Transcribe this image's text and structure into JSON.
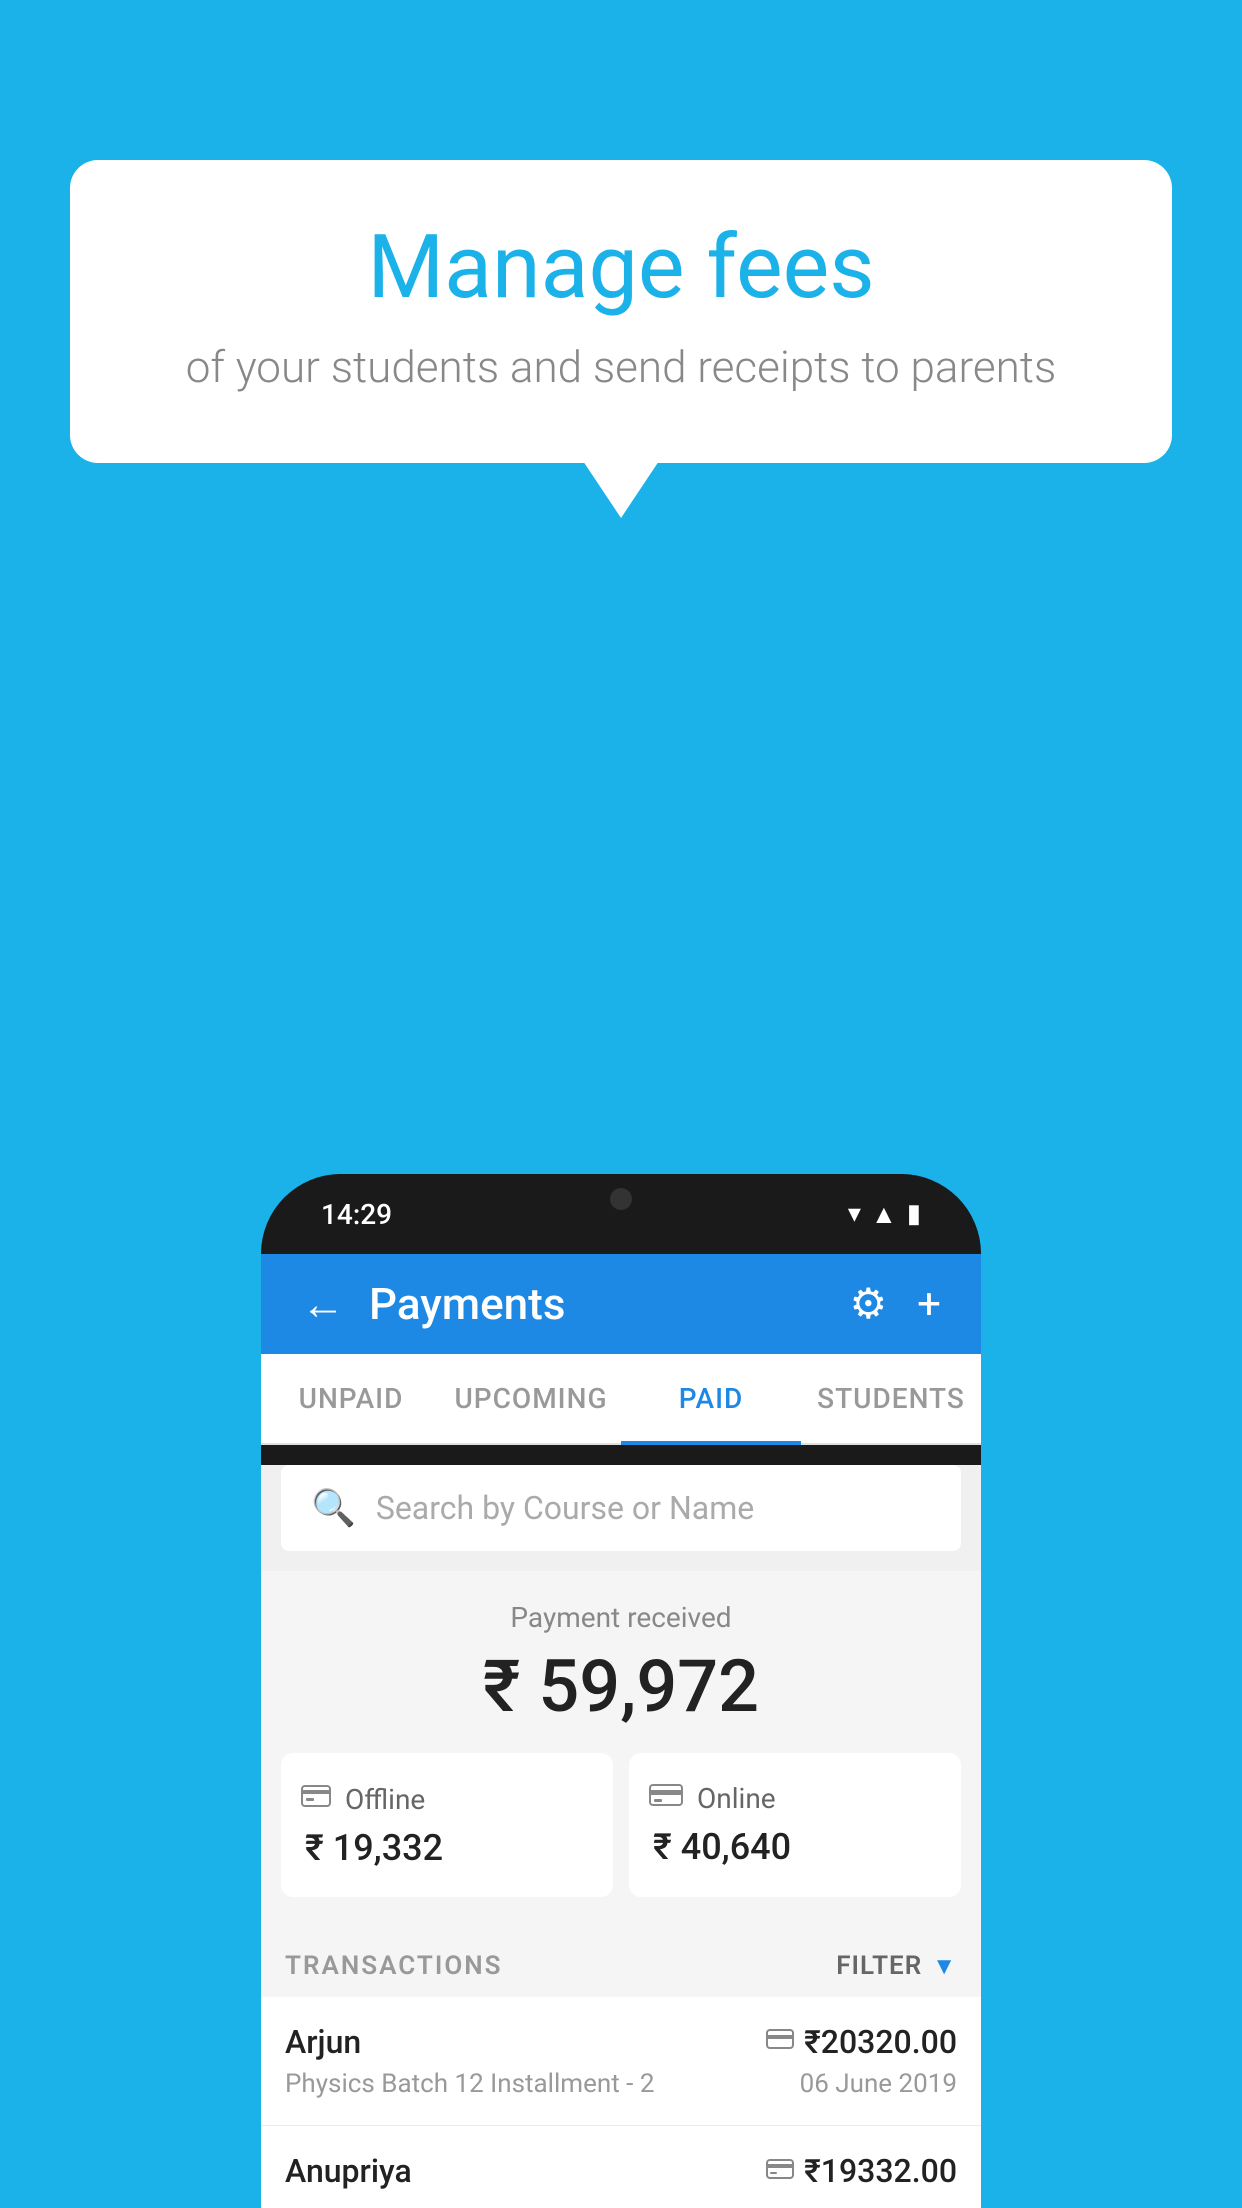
{
  "background_color": "#1ab2e8",
  "bubble": {
    "title": "Manage fees",
    "subtitle": "of your students and send receipts to parents"
  },
  "status_bar": {
    "time": "14:29",
    "icons": [
      "▾",
      "▲",
      "▮"
    ]
  },
  "header": {
    "back_label": "←",
    "title": "Payments",
    "settings_icon": "⚙",
    "add_icon": "+"
  },
  "tabs": [
    {
      "label": "UNPAID",
      "active": false
    },
    {
      "label": "UPCOMING",
      "active": false
    },
    {
      "label": "PAID",
      "active": true
    },
    {
      "label": "STUDENTS",
      "active": false
    }
  ],
  "search": {
    "placeholder": "Search by Course or Name"
  },
  "payment_received": {
    "label": "Payment received",
    "amount": "₹ 59,972",
    "offline": {
      "icon": "🗂",
      "label": "Offline",
      "amount": "₹ 19,332"
    },
    "online": {
      "icon": "💳",
      "label": "Online",
      "amount": "₹ 40,640"
    }
  },
  "transactions": {
    "label": "TRANSACTIONS",
    "filter_label": "FILTER",
    "rows": [
      {
        "name": "Arjun",
        "detail": "Physics Batch 12 Installment - 2",
        "amount": "₹20320.00",
        "date": "06 June 2019",
        "type_icon": "💳"
      },
      {
        "name": "Anupriya",
        "detail": "",
        "amount": "₹19332.00",
        "date": "",
        "type_icon": "🗂"
      }
    ]
  }
}
